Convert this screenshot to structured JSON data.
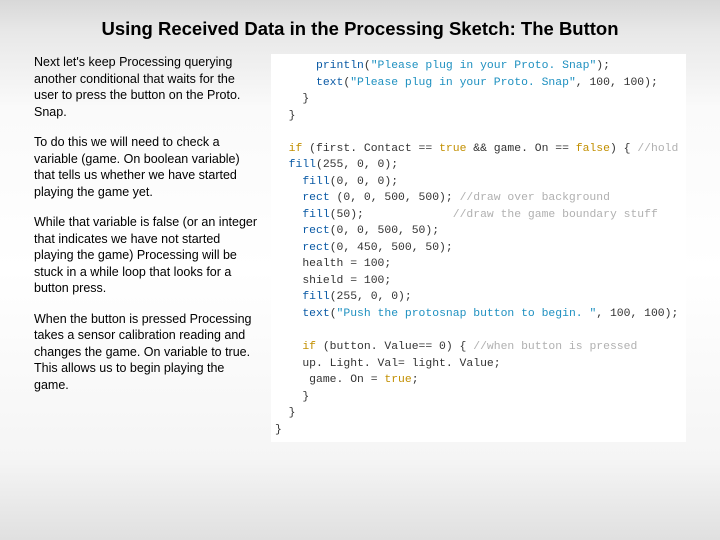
{
  "title": "Using Received Data in the Processing Sketch: The Button",
  "prose": {
    "p1": "Next let's keep Processing querying another conditional that waits for the user to press the button on the Proto. Snap.",
    "p2": "To do this we will need to check a variable (game. On boolean variable) that tells us whether we have started playing the game yet.",
    "p3": "While that variable is false (or an integer that indicates we have not started playing the game) Processing will be stuck in a while loop that looks for a button press.",
    "p4": "When the button is pressed Processing takes a sensor calibration reading and changes the game. On variable to true. This allows us to begin playing the game."
  },
  "code": {
    "l01a": "      println",
    "l01b": "(",
    "l01c": "\"Please plug in your Proto. Snap\"",
    "l01d": ");",
    "l02a": "      text",
    "l02b": "(",
    "l02c": "\"Please plug in your Proto. Snap\"",
    "l02d": ", 100, 100);",
    "l03": "    }",
    "l04": "  }",
    "l05": "",
    "l06a": "  if",
    "l06b": " (first. Contact == ",
    "l06c": "true",
    "l06d": " && game. On == ",
    "l06e": "false",
    "l06f": ") { ",
    "l06g": "//hold patt",
    "l07a": "  fill",
    "l07b": "(255, 0, 0);",
    "l08a": "    fill",
    "l08b": "(0, 0, 0);",
    "l09a": "    rect",
    "l09b": " (0, 0, 500, 500); ",
    "l09c": "//draw over background",
    "l10a": "    fill",
    "l10b": "(50);             ",
    "l10c": "//draw the game boundary stuff",
    "l11a": "    rect",
    "l11b": "(0, 0, 500, 50);",
    "l12a": "    rect",
    "l12b": "(0, 450, 500, 50);",
    "l13": "    health = 100;",
    "l14": "    shield = 100;",
    "l15a": "    fill",
    "l15b": "(255, 0, 0);",
    "l16a": "    text",
    "l16b": "(",
    "l16c": "\"Push the protosnap button to begin. \"",
    "l16d": ", 100, 100);",
    "l17": "",
    "l18a": "    if",
    "l18b": " (button. Value== 0) { ",
    "l18c": "//when button is pressed",
    "l19": "    up. Light. Val= light. Value;",
    "l20a": "     game. On = ",
    "l20b": "true",
    "l20c": ";",
    "l21": "    }",
    "l22": "  }",
    "l23": "}"
  }
}
